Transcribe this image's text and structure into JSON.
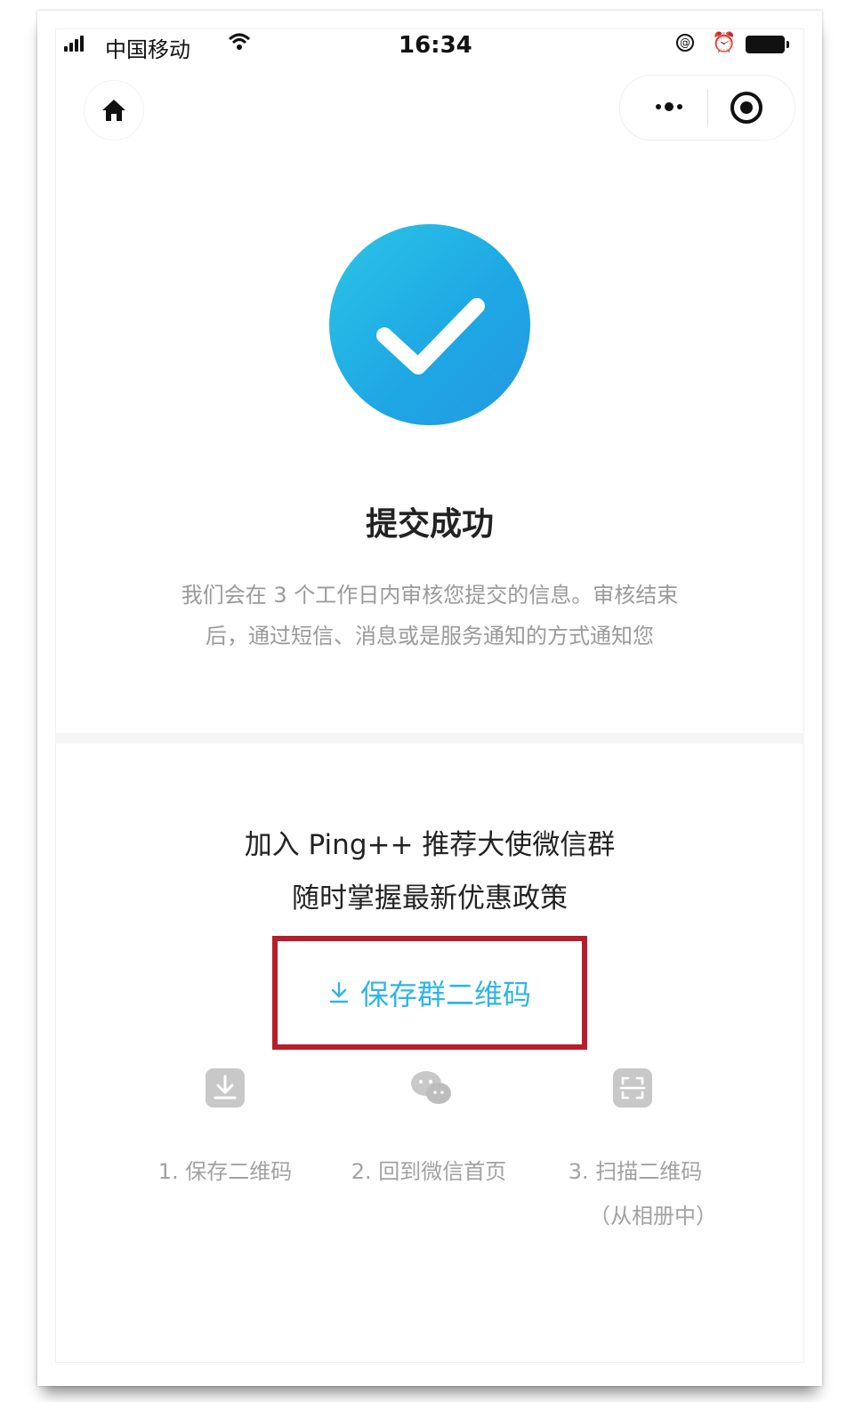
{
  "status_bar": {
    "carrier": "中国移动",
    "time": "16:34"
  },
  "icons": {
    "home": "home-icon",
    "more": "more-dots-icon",
    "close": "target-icon",
    "success": "checkmark-icon",
    "download": "download-icon",
    "wechat": "wechat-icon",
    "scan": "scan-icon"
  },
  "colors": {
    "accent": "#2fb5e6",
    "highlight_box": "#b81e2a"
  },
  "success": {
    "title": "提交成功",
    "desc_line1": "我们会在 3 个工作日内审核您提交的信息。审核结束",
    "desc_line2": "后，通过短信、消息或是服务通知的方式通知您"
  },
  "group": {
    "line1": "加入 Ping++ 推荐大使微信群",
    "line2": "随时掌握最新优惠政策"
  },
  "save_button": {
    "icon": "⤓",
    "label": "保存群二维码"
  },
  "steps": [
    {
      "label": "1. 保存二维码",
      "sub": ""
    },
    {
      "label": "2. 回到微信首页",
      "sub": ""
    },
    {
      "label": "3. 扫描二维码",
      "sub": "（从相册中）"
    }
  ]
}
